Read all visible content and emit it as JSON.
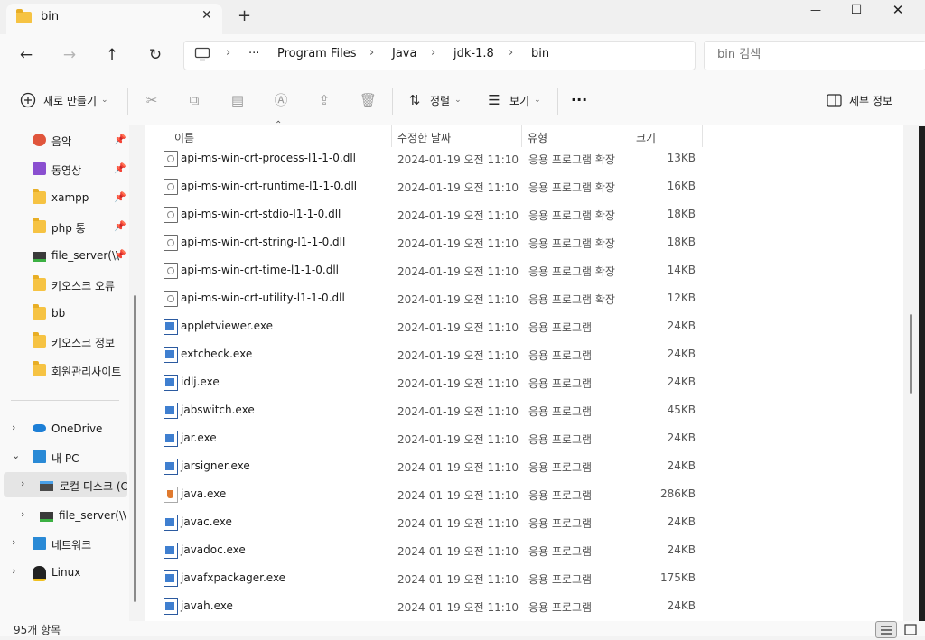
{
  "window": {
    "tab_title": "bin",
    "tab_close": "✕",
    "new_tab": "+",
    "minimize": "—",
    "maximize": "☐",
    "close": "✕"
  },
  "nav": {
    "back": "←",
    "forward": "→",
    "up": "↑",
    "refresh": "↻",
    "more": "···",
    "breadcrumbs": [
      "Program Files",
      "Java",
      "jdk-1.8",
      "bin"
    ],
    "separator": "›",
    "search_placeholder": "bin 검색"
  },
  "toolbar": {
    "new_label": "새로 만들기",
    "sort_label": "정렬",
    "view_label": "보기",
    "more": "···",
    "details_label": "세부 정보",
    "icons": [
      "cut-icon",
      "copy-icon",
      "paste-icon",
      "rename-icon",
      "share-icon",
      "delete-icon"
    ]
  },
  "sidebar": {
    "pinned": [
      {
        "label": "음악",
        "icon": "music-icon",
        "color": "#e0553c"
      },
      {
        "label": "동영상",
        "icon": "video-icon",
        "color": "#8a4fd0"
      },
      {
        "label": "xampp",
        "icon": "folder-icon"
      },
      {
        "label": "php 통",
        "icon": "folder-icon"
      },
      {
        "label": "file_server(\\\\",
        "icon": "network-drive-icon"
      },
      {
        "label": "키오스크 오류",
        "icon": "folder-icon"
      },
      {
        "label": "bb",
        "icon": "folder-icon"
      },
      {
        "label": "키오스크 정보",
        "icon": "folder-icon"
      },
      {
        "label": "회원관리사이트",
        "icon": "folder-icon"
      }
    ],
    "pin_glyph": "📌",
    "tree": [
      {
        "label": "OneDrive",
        "icon": "onedrive-icon",
        "chev": "›"
      },
      {
        "label": "내 PC",
        "icon": "pc-icon",
        "chev": "⌄"
      },
      {
        "label": "로컬 디스크 (C",
        "icon": "drive-icon",
        "chev": "›"
      },
      {
        "label": "file_server(\\\\",
        "icon": "network-drive-icon",
        "chev": "›"
      },
      {
        "label": "네트워크",
        "icon": "network-icon",
        "chev": "›"
      },
      {
        "label": "Linux",
        "icon": "linux-icon",
        "chev": "›"
      }
    ]
  },
  "columns": {
    "name": "이름",
    "date": "수정한 날짜",
    "type": "유형",
    "size": "크기"
  },
  "files": [
    {
      "name": "api-ms-win-crt-process-l1-1-0.dll",
      "date": "2024-01-19 오전 11:10",
      "type": "응용 프로그램 확장",
      "size": "13KB",
      "kind": "dll"
    },
    {
      "name": "api-ms-win-crt-runtime-l1-1-0.dll",
      "date": "2024-01-19 오전 11:10",
      "type": "응용 프로그램 확장",
      "size": "16KB",
      "kind": "dll"
    },
    {
      "name": "api-ms-win-crt-stdio-l1-1-0.dll",
      "date": "2024-01-19 오전 11:10",
      "type": "응용 프로그램 확장",
      "size": "18KB",
      "kind": "dll"
    },
    {
      "name": "api-ms-win-crt-string-l1-1-0.dll",
      "date": "2024-01-19 오전 11:10",
      "type": "응용 프로그램 확장",
      "size": "18KB",
      "kind": "dll"
    },
    {
      "name": "api-ms-win-crt-time-l1-1-0.dll",
      "date": "2024-01-19 오전 11:10",
      "type": "응용 프로그램 확장",
      "size": "14KB",
      "kind": "dll"
    },
    {
      "name": "api-ms-win-crt-utility-l1-1-0.dll",
      "date": "2024-01-19 오전 11:10",
      "type": "응용 프로그램 확장",
      "size": "12KB",
      "kind": "dll"
    },
    {
      "name": "appletviewer.exe",
      "date": "2024-01-19 오전 11:10",
      "type": "응용 프로그램",
      "size": "24KB",
      "kind": "exe"
    },
    {
      "name": "extcheck.exe",
      "date": "2024-01-19 오전 11:10",
      "type": "응용 프로그램",
      "size": "24KB",
      "kind": "exe"
    },
    {
      "name": "idlj.exe",
      "date": "2024-01-19 오전 11:10",
      "type": "응용 프로그램",
      "size": "24KB",
      "kind": "exe"
    },
    {
      "name": "jabswitch.exe",
      "date": "2024-01-19 오전 11:10",
      "type": "응용 프로그램",
      "size": "45KB",
      "kind": "exe"
    },
    {
      "name": "jar.exe",
      "date": "2024-01-19 오전 11:10",
      "type": "응용 프로그램",
      "size": "24KB",
      "kind": "exe"
    },
    {
      "name": "jarsigner.exe",
      "date": "2024-01-19 오전 11:10",
      "type": "응용 프로그램",
      "size": "24KB",
      "kind": "exe"
    },
    {
      "name": "java.exe",
      "date": "2024-01-19 오전 11:10",
      "type": "응용 프로그램",
      "size": "286KB",
      "kind": "java"
    },
    {
      "name": "javac.exe",
      "date": "2024-01-19 오전 11:10",
      "type": "응용 프로그램",
      "size": "24KB",
      "kind": "exe"
    },
    {
      "name": "javadoc.exe",
      "date": "2024-01-19 오전 11:10",
      "type": "응용 프로그램",
      "size": "24KB",
      "kind": "exe"
    },
    {
      "name": "javafxpackager.exe",
      "date": "2024-01-19 오전 11:10",
      "type": "응용 프로그램",
      "size": "175KB",
      "kind": "exe"
    },
    {
      "name": "javah.exe",
      "date": "2024-01-19 오전 11:10",
      "type": "응용 프로그램",
      "size": "24KB",
      "kind": "exe"
    }
  ],
  "status": {
    "item_count": "95개 항목"
  },
  "colors": {
    "folder": "#f6c343",
    "accent": "#2b5aa0"
  }
}
